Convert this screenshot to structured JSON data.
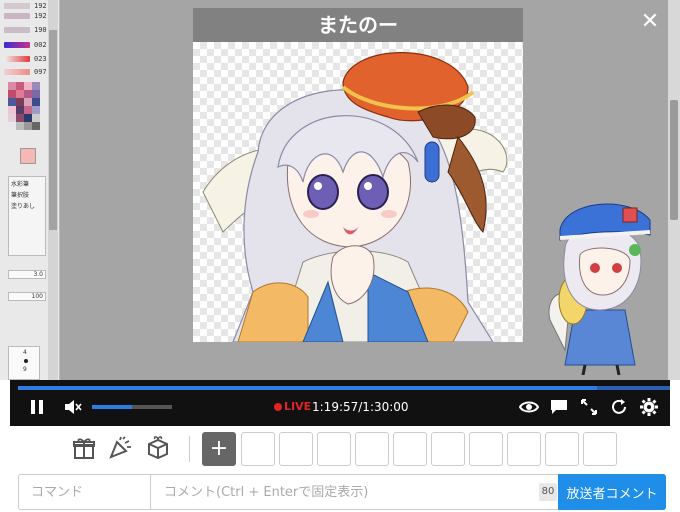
{
  "player": {
    "title": "またのー",
    "live_label": "LIVE",
    "time_display": "1:19:57/1:30:00",
    "progress": 0.888,
    "volume": 0.5
  },
  "paint_app": {
    "sliders": [
      {
        "value": "192",
        "color": "#c9b6c4"
      },
      {
        "value": "190",
        "color": "#c9bbc8"
      },
      {
        "value": "002",
        "color": "#c8318b"
      },
      {
        "value": "023",
        "color": "#e23a3a"
      },
      {
        "value": "097",
        "color": "#ee8b8b"
      }
    ],
    "tool_labels": [
      "水彩筆",
      "筆択肢",
      "塗りあし"
    ],
    "size_value": "3.0",
    "opacity_value": "100",
    "brush_sizes": [
      "4",
      "9"
    ]
  },
  "gifts": {
    "add_label": "+",
    "slot_count": 10
  },
  "comment": {
    "command_placeholder": "コマンド",
    "comment_placeholder": "コメント(Ctrl + Enterで固定表示)",
    "char_count": "80",
    "submit_label": "放送者コメント"
  },
  "colors": {
    "accent": "#1f8ee8",
    "live": "#e02424",
    "progress": "#2f7be6",
    "controls_bg": "#111111"
  },
  "icons": {
    "close": "close-icon",
    "play_pause": "pause-icon",
    "volume": "mute-icon",
    "live_dot": "live-dot-icon",
    "eye": "eye-icon",
    "comment": "comment-bubble-icon",
    "fullscreen": "fullscreen-icon",
    "reload": "reload-icon",
    "settings": "gear-icon",
    "gift": "gift-icon",
    "party": "party-popper-icon",
    "giftbox": "gift-box-icon"
  }
}
